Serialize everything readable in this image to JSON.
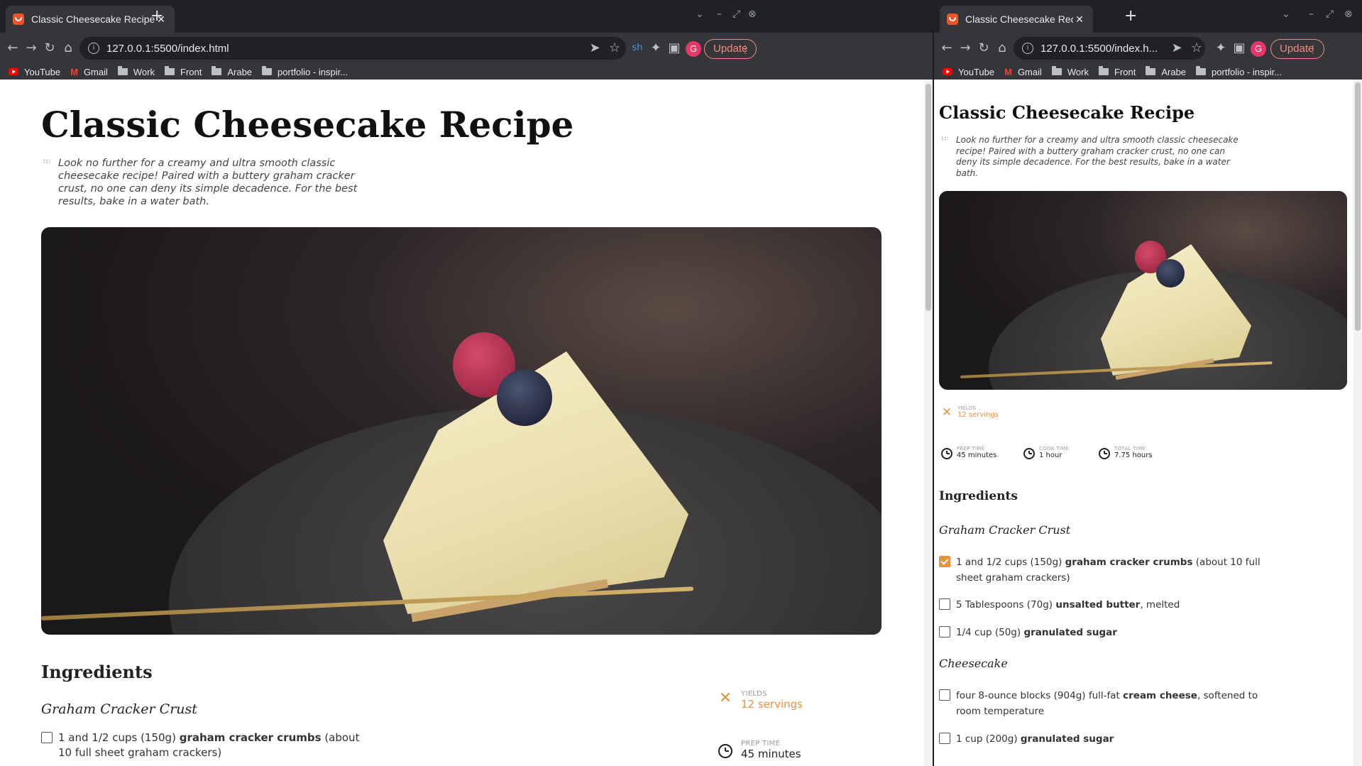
{
  "browser": {
    "tab_title": "Classic Cheesecake Recipe | Ru",
    "tab_title_narrow": "Classic Cheesecake Recipe | Ri",
    "url": "127.0.0.1:5500/index.html",
    "url_narrow": "127.0.0.1:5500/index.h...",
    "update_label": "Update",
    "profile_initial": "G",
    "bookmarks": [
      {
        "label": "YouTube",
        "icon": "youtube-icon"
      },
      {
        "label": "Gmail",
        "icon": "gmail-icon"
      },
      {
        "label": "Work",
        "icon": "folder-icon"
      },
      {
        "label": "Front",
        "icon": "folder-icon"
      },
      {
        "label": "Arabe",
        "icon": "folder-icon"
      },
      {
        "label": "portfolio - inspir...",
        "icon": "folder-icon"
      }
    ]
  },
  "recipe": {
    "title": "Classic Cheesecake Recipe",
    "description": "Look no further for a creamy and ultra smooth classic cheesecake recipe! Paired with a buttery graham cracker crust, no one can deny its simple decadence. For the best results, bake in a water bath.",
    "ingredients_heading": "Ingredients",
    "sections": [
      {
        "name": "Graham Cracker Crust",
        "items": [
          {
            "pre": "1 and 1/2 cups (150g) ",
            "bold": "graham cracker crumbs",
            "post": " (about 10 full sheet graham crackers)",
            "checked_wide": false,
            "checked_narrow": true
          },
          {
            "pre": "5 Tablespoons (70g) ",
            "bold": "unsalted butter",
            "post": ", melted",
            "checked_narrow": false
          },
          {
            "pre": "1/4 cup (50g) ",
            "bold": "granulated sugar",
            "post": "",
            "checked_narrow": false
          }
        ]
      },
      {
        "name": "Cheesecake",
        "items": [
          {
            "pre": "four 8-ounce blocks (904g) full-fat ",
            "bold": "cream cheese",
            "post": ", softened to room temperature",
            "checked_narrow": false
          },
          {
            "pre": "1 cup (200g) ",
            "bold": "granulated sugar",
            "post": "",
            "checked_narrow": false
          }
        ]
      }
    ],
    "meta": {
      "yields_label": "YIELDS",
      "yields_value": "12 servings",
      "prep_label": "PREP TIME",
      "prep_value": "45 minutes",
      "cook_label": "COOK TIME",
      "cook_value": "1 hour",
      "total_label": "TOTAL TIME",
      "total_value": "7.75 hours"
    }
  },
  "colors": {
    "accent": "#e8913f",
    "chrome_bg": "#35363a",
    "tabstrip_bg": "#202124",
    "update_red": "#f28b82"
  }
}
